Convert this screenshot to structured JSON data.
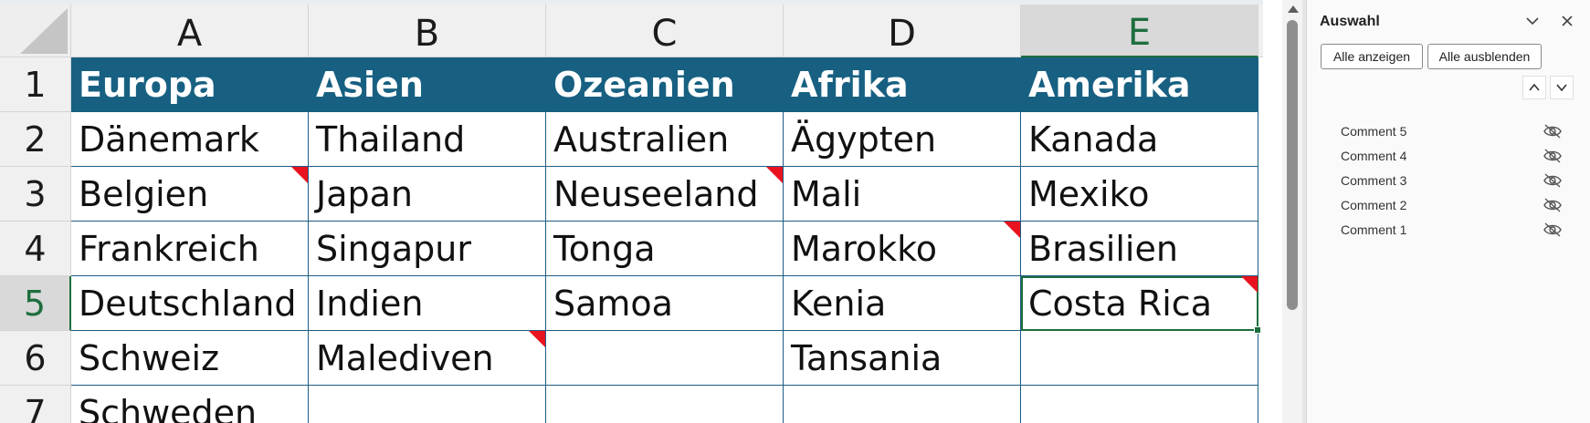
{
  "sheet": {
    "columns": [
      "A",
      "B",
      "C",
      "D",
      "E"
    ],
    "rows": [
      "1",
      "2",
      "3",
      "4",
      "5",
      "6",
      "7"
    ],
    "selected_cell": "E5",
    "headers": [
      "Europa",
      "Asien",
      "Ozeanien",
      "Afrika",
      "Amerika"
    ],
    "data": [
      [
        "Dänemark",
        "Thailand",
        "Australien",
        "Ägypten",
        "Kanada"
      ],
      [
        "Belgien",
        "Japan",
        "Neuseeland",
        "Mali",
        "Mexiko"
      ],
      [
        "Frankreich",
        "Singapur",
        "Tonga",
        "Marokko",
        "Brasilien"
      ],
      [
        "Deutschland",
        "Indien",
        "Samoa",
        "Kenia",
        "Costa Rica"
      ],
      [
        "Schweiz",
        "Malediven",
        "",
        "Tansania",
        ""
      ],
      [
        "Schweden",
        "",
        "",
        "",
        ""
      ]
    ],
    "comment_cells": [
      "A3",
      "C3",
      "D4",
      "E5",
      "B6"
    ],
    "colors": {
      "header_fill": "#176082",
      "header_text": "#ffffff",
      "cell_border": "#1f5c85",
      "selection": "#1e6e3f",
      "comment_marker": "#e8131f"
    }
  },
  "selection_pane": {
    "title": "Auswahl",
    "title_icons": [
      "chevron-down-icon",
      "close-icon"
    ],
    "show_all_label": "Alle anzeigen",
    "hide_all_label": "Alle ausblenden",
    "order_icons": [
      "chevron-up-icon",
      "chevron-down-icon"
    ],
    "items": [
      {
        "label": "Comment 5",
        "visibility": "hidden",
        "icon": "eye-slash-icon"
      },
      {
        "label": "Comment 4",
        "visibility": "hidden",
        "icon": "eye-slash-icon"
      },
      {
        "label": "Comment 3",
        "visibility": "hidden",
        "icon": "eye-slash-icon"
      },
      {
        "label": "Comment 2",
        "visibility": "hidden",
        "icon": "eye-slash-icon"
      },
      {
        "label": "Comment 1",
        "visibility": "hidden",
        "icon": "eye-slash-icon"
      }
    ]
  }
}
